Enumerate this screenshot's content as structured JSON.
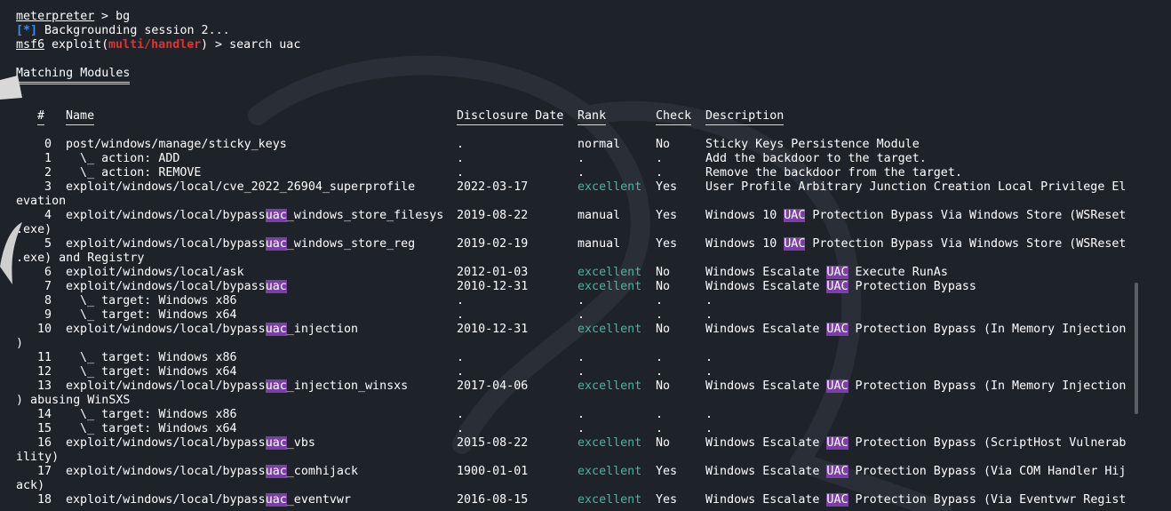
{
  "session": {
    "line1_prompt": "meterpreter",
    "line1_cmd": " > bg",
    "line2_tag": "[*]",
    "line2_msg": " Backgrounding session 2...",
    "line3_prompt": "msf6",
    "line3_exploit": " exploit(",
    "line3_module": "multi/handler",
    "line3_tail": ") > search uac"
  },
  "heading": "Matching Modules",
  "columns": {
    "num": "#",
    "name": "Name",
    "date": "Disclosure Date",
    "rank": "Rank",
    "check": "Check",
    "desc": "Description"
  },
  "highlight_term": "uac",
  "highlight_term_upper": "UAC",
  "rows": [
    {
      "num": "0",
      "name": "post/windows/manage/sticky_keys",
      "date": ".",
      "rank": "normal",
      "check": "No",
      "desc": "Sticky Keys Persistence Module",
      "wrap": ""
    },
    {
      "num": "1",
      "name": "  \\_ action: ADD",
      "date": ".",
      "rank": ".",
      "check": ".",
      "desc": "Add the backdoor to the target.",
      "wrap": ""
    },
    {
      "num": "2",
      "name": "  \\_ action: REMOVE",
      "date": ".",
      "rank": ".",
      "check": ".",
      "desc": "Remove the backdoor from the target.",
      "wrap": ""
    },
    {
      "num": "3",
      "name": "exploit/windows/local/cve_2022_26904_superprofile",
      "date": "2022-03-17",
      "rank": "excellent",
      "check": "Yes",
      "desc": "User Profile Arbitrary Junction Creation Local Privilege El",
      "wrap": "evation"
    },
    {
      "num": "4",
      "name": "exploit/windows/local/bypassuac_windows_store_filesys",
      "date": "2019-08-22",
      "rank": "manual",
      "check": "Yes",
      "desc": "Windows 10 UAC Protection Bypass Via Windows Store (WSReset",
      "wrap": ".exe)"
    },
    {
      "num": "5",
      "name": "exploit/windows/local/bypassuac_windows_store_reg",
      "date": "2019-02-19",
      "rank": "manual",
      "check": "Yes",
      "desc": "Windows 10 UAC Protection Bypass Via Windows Store (WSReset",
      "wrap": ".exe) and Registry"
    },
    {
      "num": "6",
      "name": "exploit/windows/local/ask",
      "date": "2012-01-03",
      "rank": "excellent",
      "check": "No",
      "desc": "Windows Escalate UAC Execute RunAs",
      "wrap": ""
    },
    {
      "num": "7",
      "name": "exploit/windows/local/bypassuac",
      "date": "2010-12-31",
      "rank": "excellent",
      "check": "No",
      "desc": "Windows Escalate UAC Protection Bypass",
      "wrap": ""
    },
    {
      "num": "8",
      "name": "  \\_ target: Windows x86",
      "date": ".",
      "rank": ".",
      "check": ".",
      "desc": ".",
      "wrap": ""
    },
    {
      "num": "9",
      "name": "  \\_ target: Windows x64",
      "date": ".",
      "rank": ".",
      "check": ".",
      "desc": ".",
      "wrap": ""
    },
    {
      "num": "10",
      "name": "exploit/windows/local/bypassuac_injection",
      "date": "2010-12-31",
      "rank": "excellent",
      "check": "No",
      "desc": "Windows Escalate UAC Protection Bypass (In Memory Injection",
      "wrap": ")"
    },
    {
      "num": "11",
      "name": "  \\_ target: Windows x86",
      "date": ".",
      "rank": ".",
      "check": ".",
      "desc": ".",
      "wrap": ""
    },
    {
      "num": "12",
      "name": "  \\_ target: Windows x64",
      "date": ".",
      "rank": ".",
      "check": ".",
      "desc": ".",
      "wrap": ""
    },
    {
      "num": "13",
      "name": "exploit/windows/local/bypassuac_injection_winsxs",
      "date": "2017-04-06",
      "rank": "excellent",
      "check": "No",
      "desc": "Windows Escalate UAC Protection Bypass (In Memory Injection",
      "wrap": ") abusing WinSXS"
    },
    {
      "num": "14",
      "name": "  \\_ target: Windows x86",
      "date": ".",
      "rank": ".",
      "check": ".",
      "desc": ".",
      "wrap": ""
    },
    {
      "num": "15",
      "name": "  \\_ target: Windows x64",
      "date": ".",
      "rank": ".",
      "check": ".",
      "desc": ".",
      "wrap": ""
    },
    {
      "num": "16",
      "name": "exploit/windows/local/bypassuac_vbs",
      "date": "2015-08-22",
      "rank": "excellent",
      "check": "No",
      "desc": "Windows Escalate UAC Protection Bypass (ScriptHost Vulnerab",
      "wrap": "ility)"
    },
    {
      "num": "17",
      "name": "exploit/windows/local/bypassuac_comhijack",
      "date": "1900-01-01",
      "rank": "excellent",
      "check": "Yes",
      "desc": "Windows Escalate UAC Protection Bypass (Via COM Handler Hij",
      "wrap": "ack)"
    },
    {
      "num": "18",
      "name": "exploit/windows/local/bypassuac_eventvwr",
      "date": "2016-08-15",
      "rank": "excellent",
      "check": "Yes",
      "desc": "Windows Escalate UAC Protection Bypass (Via Eventvwr Regist",
      "wrap": ""
    }
  ],
  "colors": {
    "background": "#1e2229",
    "prompt_module": "#e33131",
    "status_tag": "#3f8bf0",
    "rank_excellent": "#4cb3a0",
    "highlight": "#7b3fa6"
  }
}
